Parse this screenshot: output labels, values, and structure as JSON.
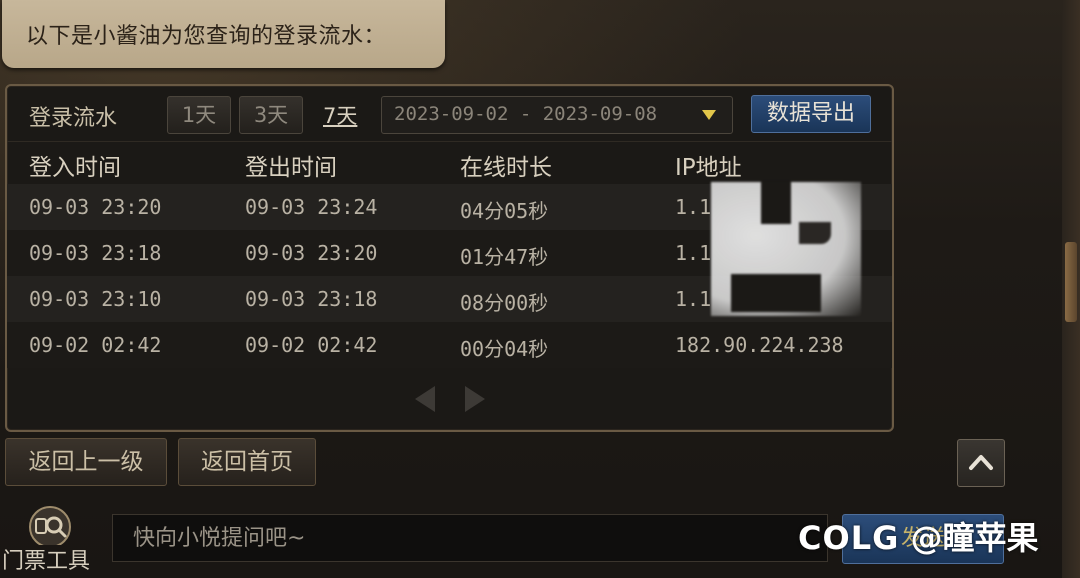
{
  "bubble": {
    "text": "以下是小酱油为您查询的登录流水："
  },
  "toolbar": {
    "label": "登录流水",
    "btn_1day": "1天",
    "btn_3day": "3天",
    "btn_7day": "7天",
    "date_range": "2023-09-02 - 2023-09-08",
    "export": "数据导出"
  },
  "table": {
    "headers": [
      "登入时间",
      "登出时间",
      "在线时长",
      "IP地址"
    ],
    "rows": [
      {
        "login": "09-03 23:20",
        "logout": "09-03 23:24",
        "duration": "04分05秒",
        "ip": "1.1"
      },
      {
        "login": "09-03 23:18",
        "logout": "09-03 23:20",
        "duration": "01分47秒",
        "ip": "1.1"
      },
      {
        "login": "09-03 23:10",
        "logout": "09-03 23:18",
        "duration": "08分00秒",
        "ip": "1.1"
      },
      {
        "login": "09-02 02:42",
        "logout": "09-02 02:42",
        "duration": "00分04秒",
        "ip": "182.90.224.238"
      }
    ]
  },
  "nav": {
    "back": "返回上一级",
    "home": "返回首页"
  },
  "bottom": {
    "ticket_tool": "门票工具",
    "input_placeholder": "快向小悦提问吧~",
    "send": "发送"
  },
  "watermark": {
    "logo": "COLG",
    "handle": "@瞳苹果"
  },
  "colors": {
    "accent_blue": "#1a3558",
    "gold_arrow": "#e2c64a",
    "bubble_bg": "#c7b79b"
  }
}
